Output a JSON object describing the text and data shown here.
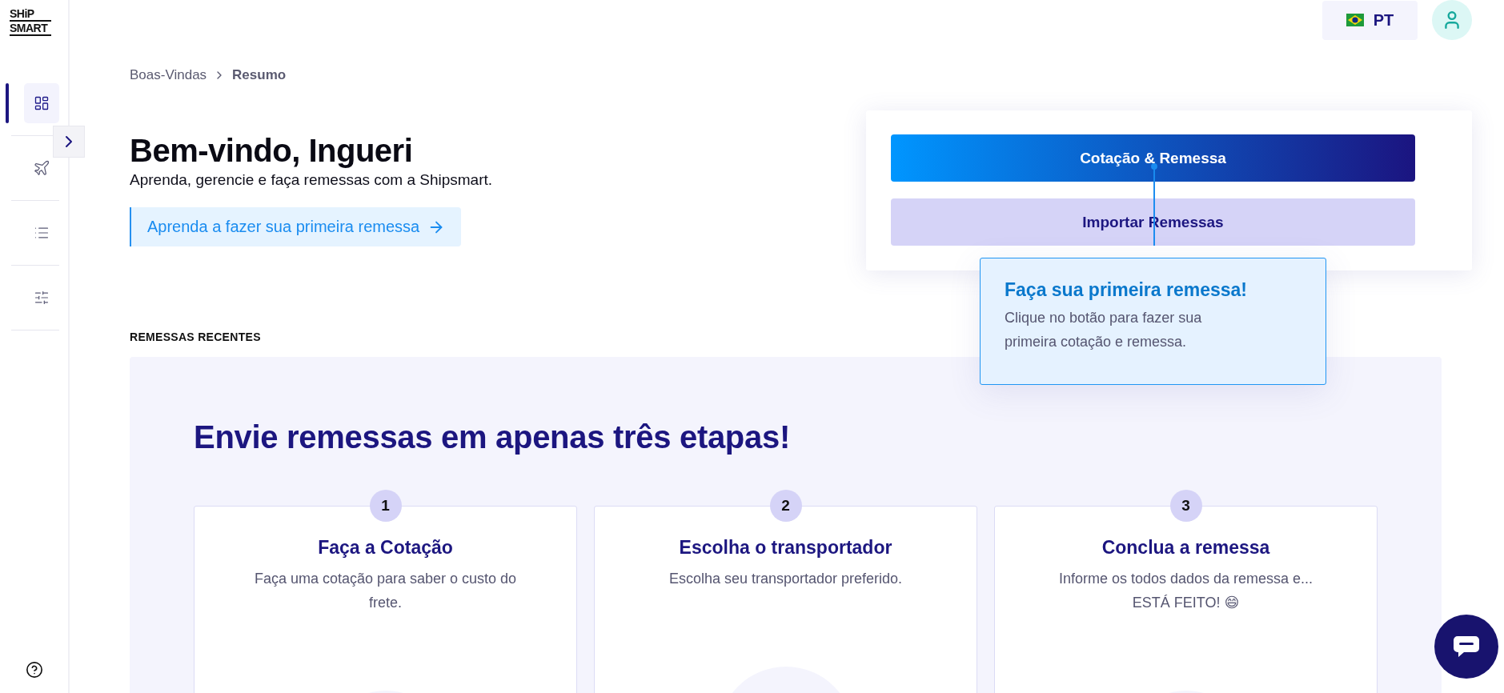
{
  "logo": {
    "lines": [
      "SHiP",
      "SMART"
    ]
  },
  "sidebar": {
    "items": [
      {
        "kind": "dashboard",
        "selected": true
      },
      {
        "kind": "plane",
        "selected": false
      },
      {
        "kind": "list",
        "selected": false
      },
      {
        "kind": "sliders",
        "selected": false
      }
    ],
    "expanded": false
  },
  "header": {
    "language": {
      "label": "PT"
    }
  },
  "breadcrumb": [
    {
      "label": "Boas-Vindas",
      "current": false
    },
    {
      "label": "Resumo",
      "current": true
    }
  ],
  "hero": {
    "title": "Bem-vindo, Ingueri",
    "subtitle": "Aprenda, gerencie e faça remessas com a Shipsmart.",
    "link": "Aprenda a fazer sua primeira remessa"
  },
  "actions": [
    {
      "label": "Cotação & Remessa",
      "kind": "primary"
    },
    {
      "label": "Importar Remessas",
      "kind": "secondary"
    }
  ],
  "tooltip": {
    "title": "Faça sua primeira remessa!",
    "lines": [
      "Clique no botão para fazer sua",
      "primeira cotação e remessa."
    ]
  },
  "section_title": "REMESSAS RECENTES",
  "steps_panel": {
    "title": "Envie remessas em apenas três etapas!",
    "steps": [
      {
        "number": "1",
        "title": "Faça a Cotação",
        "lines": [
          "Faça uma cotação para saber o custo do",
          "frete."
        ]
      },
      {
        "number": "2",
        "title": "Escolha o transportador",
        "lines": [
          "Escolha seu transportador preferido."
        ]
      },
      {
        "number": "3",
        "title": "Conclua a remessa",
        "lines": [
          "Informe os todos dados da remessa e...",
          "ESTÁ FEITO! 😄"
        ]
      }
    ]
  }
}
